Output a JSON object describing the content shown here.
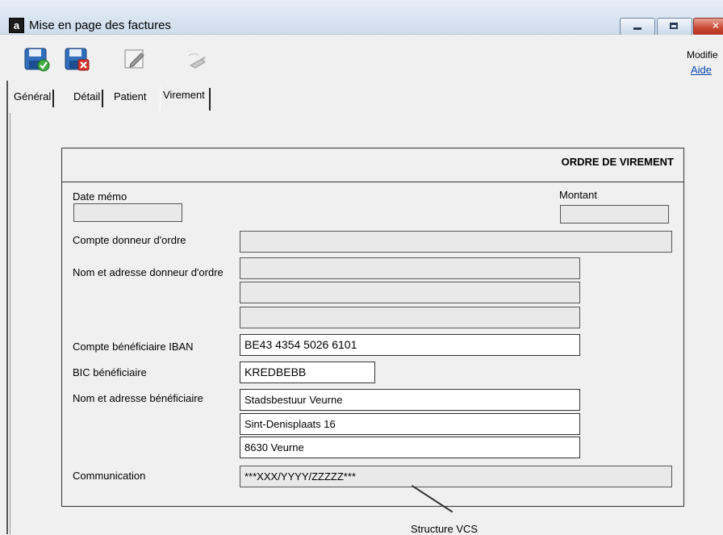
{
  "window": {
    "app_icon_letter": "a",
    "title": "Mise en page des factures"
  },
  "toolbar": {
    "modifier_label": "Modifie",
    "aide_label": "Aide",
    "buttons": [
      "save-icon",
      "save-cancel-icon",
      "edit-icon",
      "clear-icon"
    ]
  },
  "tabs": [
    {
      "label": "Général"
    },
    {
      "label": "Détail"
    },
    {
      "label": "Patient"
    },
    {
      "label": "Virement",
      "active": true
    }
  ],
  "form": {
    "title": "ORDRE DE VIREMENT",
    "date_memo_label": "Date mémo",
    "date_memo_value": "",
    "montant_label": "Montant",
    "montant_value": "",
    "compte_donneur_label": "Compte donneur d'ordre",
    "compte_donneur_value": "",
    "nom_adresse_donneur_label": "Nom et adresse donneur d'ordre",
    "nom_adresse_donneur_lines": [
      "",
      "",
      ""
    ],
    "compte_beneficiaire_label": "Compte bénéficiaire IBAN",
    "compte_beneficiaire_value": "BE43 4354 5026 6101",
    "bic_label": "BIC bénéficiaire",
    "bic_value": "KREDBEBB",
    "nom_adresse_beneficiaire_label": "Nom et adresse bénéficiaire",
    "nom_adresse_beneficiaire_lines": [
      "Stadsbestuur Veurne",
      "Sint-Denisplaats 16",
      "8630 Veurne"
    ],
    "communication_label": "Communication",
    "communication_value": "***XXX/YYYY/ZZZZZ***",
    "vcs_annotation": "Structure VCS"
  },
  "colors": {
    "titlebar": "#d9e4f1",
    "link": "#0645ad",
    "close_button": "#c74531"
  }
}
